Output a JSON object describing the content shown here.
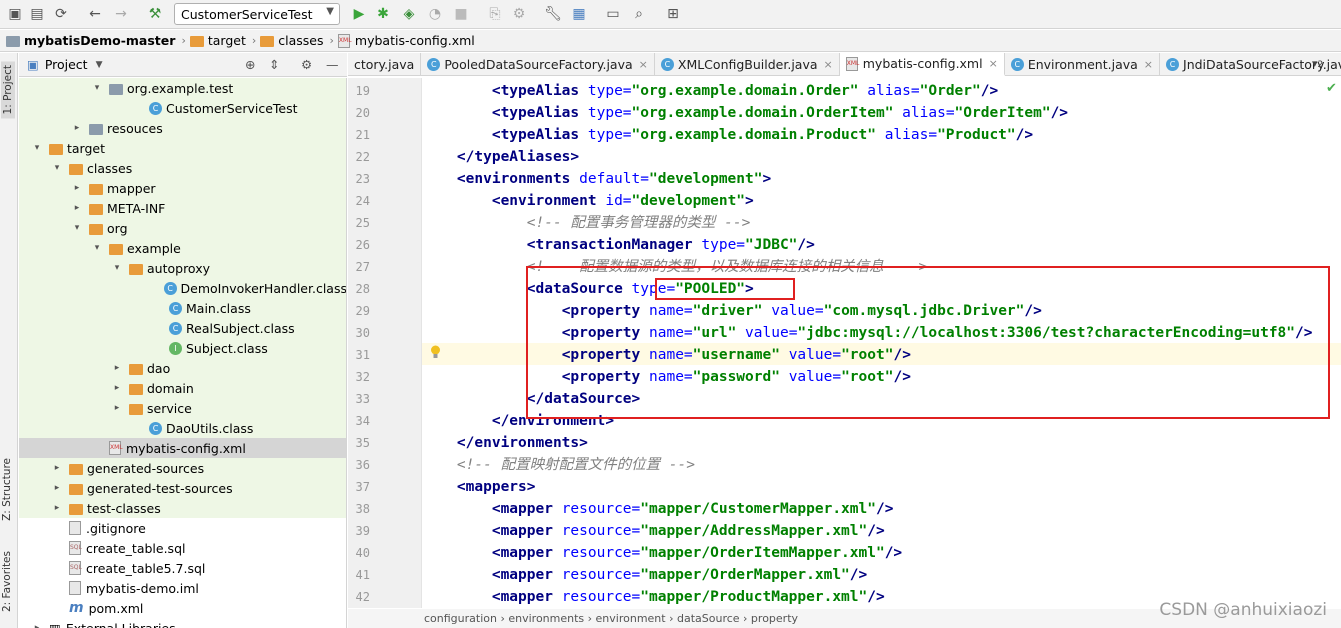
{
  "toolbar": {
    "run_config": "CustomerServiceTest",
    "icons": [
      "open-icon",
      "save-icon",
      "sync-icon",
      "back-icon",
      "forward-icon",
      "build-hammer-icon",
      "run-icon",
      "debug-icon",
      "coverage-icon",
      "profile-icon",
      "stop-icon",
      "vcs-icon",
      "vcs-update-icon",
      "settings-wrench-icon",
      "project-structure-icon",
      "terminal-icon",
      "search-icon",
      "sdk-icon"
    ]
  },
  "breadcrumb": [
    "mybatisDemo-master",
    "target",
    "classes",
    "mybatis-config.xml"
  ],
  "left_strip": {
    "project_tab": "1: Project",
    "structure_tab": "Z: Structure",
    "favorites_tab": "2: Favorites"
  },
  "project_panel": {
    "title": "Project"
  },
  "tree": [
    {
      "label": "org.example.test",
      "indent": 4,
      "arrow": "▾",
      "icon": "pkg",
      "green": true
    },
    {
      "label": "CustomerServiceTest",
      "indent": 6,
      "arrow": "",
      "icon": "class",
      "green": true
    },
    {
      "label": "resouces",
      "indent": 3,
      "arrow": "▸",
      "icon": "folder-gray",
      "green": true
    },
    {
      "label": "target",
      "indent": 1,
      "arrow": "▾",
      "icon": "folder-orange",
      "green": true
    },
    {
      "label": "classes",
      "indent": 2,
      "arrow": "▾",
      "icon": "folder-orange",
      "green": true
    },
    {
      "label": "mapper",
      "indent": 3,
      "arrow": "▸",
      "icon": "folder-orange",
      "green": true
    },
    {
      "label": "META-INF",
      "indent": 3,
      "arrow": "▸",
      "icon": "folder-orange",
      "green": true
    },
    {
      "label": "org",
      "indent": 3,
      "arrow": "▾",
      "icon": "folder-orange",
      "green": true
    },
    {
      "label": "example",
      "indent": 4,
      "arrow": "▾",
      "icon": "folder-orange",
      "green": true
    },
    {
      "label": "autoproxy",
      "indent": 5,
      "arrow": "▾",
      "icon": "folder-orange",
      "green": true
    },
    {
      "label": "DemoInvokerHandler.class",
      "indent": 7,
      "arrow": "",
      "icon": "class",
      "green": true
    },
    {
      "label": "Main.class",
      "indent": 7,
      "arrow": "",
      "icon": "class",
      "green": true
    },
    {
      "label": "RealSubject.class",
      "indent": 7,
      "arrow": "",
      "icon": "class",
      "green": true
    },
    {
      "label": "Subject.class",
      "indent": 7,
      "arrow": "",
      "icon": "iface",
      "green": true
    },
    {
      "label": "dao",
      "indent": 5,
      "arrow": "▸",
      "icon": "folder-orange",
      "green": true
    },
    {
      "label": "domain",
      "indent": 5,
      "arrow": "▸",
      "icon": "folder-orange",
      "green": true
    },
    {
      "label": "service",
      "indent": 5,
      "arrow": "▸",
      "icon": "folder-orange",
      "green": true
    },
    {
      "label": "DaoUtils.class",
      "indent": 6,
      "arrow": "",
      "icon": "class",
      "green": true
    },
    {
      "label": "mybatis-config.xml",
      "indent": 4,
      "arrow": "",
      "icon": "xml",
      "sel": true
    },
    {
      "label": "generated-sources",
      "indent": 2,
      "arrow": "▸",
      "icon": "folder-orange",
      "green": true
    },
    {
      "label": "generated-test-sources",
      "indent": 2,
      "arrow": "▸",
      "icon": "folder-orange",
      "green": true
    },
    {
      "label": "test-classes",
      "indent": 2,
      "arrow": "▸",
      "icon": "folder-orange",
      "green": true
    },
    {
      "label": ".gitignore",
      "indent": 2,
      "arrow": "",
      "icon": "file"
    },
    {
      "label": "create_table.sql",
      "indent": 2,
      "arrow": "",
      "icon": "sql"
    },
    {
      "label": "create_table5.7.sql",
      "indent": 2,
      "arrow": "",
      "icon": "sql"
    },
    {
      "label": "mybatis-demo.iml",
      "indent": 2,
      "arrow": "",
      "icon": "file"
    },
    {
      "label": "pom.xml",
      "indent": 2,
      "arrow": "",
      "icon": "maven"
    },
    {
      "label": "External Libraries",
      "indent": 1,
      "arrow": "▸",
      "icon": "lib"
    }
  ],
  "tabs": [
    {
      "label": "ctory.java",
      "active": false,
      "icon": "class"
    },
    {
      "label": "PooledDataSourceFactory.java",
      "active": false,
      "icon": "class"
    },
    {
      "label": "XMLConfigBuilder.java",
      "active": false,
      "icon": "class"
    },
    {
      "label": "mybatis-config.xml",
      "active": true,
      "icon": "xml"
    },
    {
      "label": "Environment.java",
      "active": false,
      "icon": "class"
    },
    {
      "label": "JndiDataSourceFactory.java",
      "active": false,
      "icon": "class"
    }
  ],
  "tab_overflow": "2",
  "line_numbers": [
    "19",
    "20",
    "21",
    "22",
    "23",
    "24",
    "25",
    "26",
    "27",
    "28",
    "29",
    "30",
    "31",
    "32",
    "33",
    "34",
    "35",
    "36",
    "37",
    "38",
    "39",
    "40",
    "41",
    "42"
  ],
  "code_lines": [
    [
      [
        "i",
        "        "
      ],
      [
        "t",
        "<typeAlias "
      ],
      [
        "a",
        "type="
      ],
      [
        "v",
        "\"org.example.domain.Order\""
      ],
      [
        "a",
        " alias="
      ],
      [
        "v",
        "\"Order\""
      ],
      [
        "t",
        "/>"
      ]
    ],
    [
      [
        "i",
        "        "
      ],
      [
        "t",
        "<typeAlias "
      ],
      [
        "a",
        "type="
      ],
      [
        "v",
        "\"org.example.domain.OrderItem\""
      ],
      [
        "a",
        " alias="
      ],
      [
        "v",
        "\"OrderItem\""
      ],
      [
        "t",
        "/>"
      ]
    ],
    [
      [
        "i",
        "        "
      ],
      [
        "t",
        "<typeAlias "
      ],
      [
        "a",
        "type="
      ],
      [
        "v",
        "\"org.example.domain.Product\""
      ],
      [
        "a",
        " alias="
      ],
      [
        "v",
        "\"Product\""
      ],
      [
        "t",
        "/>"
      ]
    ],
    [
      [
        "i",
        "    "
      ],
      [
        "t",
        "</typeAliases>"
      ]
    ],
    [
      [
        "i",
        "    "
      ],
      [
        "t",
        "<environments "
      ],
      [
        "a",
        "default="
      ],
      [
        "v",
        "\"development\""
      ],
      [
        "t",
        ">"
      ]
    ],
    [
      [
        "i",
        "        "
      ],
      [
        "t",
        "<environment "
      ],
      [
        "a",
        "id="
      ],
      [
        "v",
        "\"development\""
      ],
      [
        "t",
        ">"
      ]
    ],
    [
      [
        "i",
        "            "
      ],
      [
        "c",
        "<!-- 配置事务管理器的类型 -->"
      ]
    ],
    [
      [
        "i",
        "            "
      ],
      [
        "t",
        "<transactionManager "
      ],
      [
        "a",
        "type="
      ],
      [
        "v",
        "\"JDBC\""
      ],
      [
        "t",
        "/>"
      ]
    ],
    [
      [
        "i",
        "            "
      ],
      [
        "c",
        "<!--  配置数据源的类型，以及数据库连接的相关信息  -->"
      ]
    ],
    [
      [
        "i",
        "            "
      ],
      [
        "t",
        "<dataSource "
      ],
      [
        "a",
        "type="
      ],
      [
        "v",
        "\"POOLED\""
      ],
      [
        "t",
        ">"
      ]
    ],
    [
      [
        "i",
        "                "
      ],
      [
        "t",
        "<property "
      ],
      [
        "a",
        "name="
      ],
      [
        "v",
        "\"driver\""
      ],
      [
        "a",
        " value="
      ],
      [
        "v",
        "\"com.mysql.jdbc.Driver\""
      ],
      [
        "t",
        "/>"
      ]
    ],
    [
      [
        "i",
        "                "
      ],
      [
        "t",
        "<property "
      ],
      [
        "a",
        "name="
      ],
      [
        "v",
        "\"url\""
      ],
      [
        "a",
        " value="
      ],
      [
        "v",
        "\"jdbc:mysql://localhost:3306/test?characterEncoding=utf8\""
      ],
      [
        "t",
        "/>"
      ]
    ],
    [
      [
        "i",
        "                "
      ],
      [
        "t",
        "<property "
      ],
      [
        "a",
        "name="
      ],
      [
        "v",
        "\"username\""
      ],
      [
        "a",
        " value="
      ],
      [
        "v",
        "\"root\""
      ],
      [
        "t",
        "/>"
      ]
    ],
    [
      [
        "i",
        "                "
      ],
      [
        "t",
        "<property "
      ],
      [
        "a",
        "name="
      ],
      [
        "v",
        "\"password\""
      ],
      [
        "a",
        " value="
      ],
      [
        "v",
        "\"root\""
      ],
      [
        "t",
        "/>"
      ]
    ],
    [
      [
        "i",
        "            "
      ],
      [
        "t",
        "</dataSource>"
      ]
    ],
    [
      [
        "i",
        "        "
      ],
      [
        "t",
        "</environment>"
      ]
    ],
    [
      [
        "i",
        "    "
      ],
      [
        "t",
        "</environments>"
      ]
    ],
    [
      [
        "i",
        "    "
      ],
      [
        "c",
        "<!-- 配置映射配置文件的位置 -->"
      ]
    ],
    [
      [
        "i",
        "    "
      ],
      [
        "t",
        "<mappers>"
      ]
    ],
    [
      [
        "i",
        "        "
      ],
      [
        "t",
        "<mapper "
      ],
      [
        "a",
        "resource="
      ],
      [
        "v",
        "\"mapper/CustomerMapper.xml\""
      ],
      [
        "t",
        "/>"
      ]
    ],
    [
      [
        "i",
        "        "
      ],
      [
        "t",
        "<mapper "
      ],
      [
        "a",
        "resource="
      ],
      [
        "v",
        "\"mapper/AddressMapper.xml\""
      ],
      [
        "t",
        "/>"
      ]
    ],
    [
      [
        "i",
        "        "
      ],
      [
        "t",
        "<mapper "
      ],
      [
        "a",
        "resource="
      ],
      [
        "v",
        "\"mapper/OrderItemMapper.xml\""
      ],
      [
        "t",
        "/>"
      ]
    ],
    [
      [
        "i",
        "        "
      ],
      [
        "t",
        "<mapper "
      ],
      [
        "a",
        "resource="
      ],
      [
        "v",
        "\"mapper/OrderMapper.xml\""
      ],
      [
        "t",
        "/>"
      ]
    ],
    [
      [
        "i",
        "        "
      ],
      [
        "t",
        "<mapper "
      ],
      [
        "a",
        "resource="
      ],
      [
        "v",
        "\"mapper/ProductMapper.xml\""
      ],
      [
        "t",
        "/>"
      ]
    ]
  ],
  "status_path": "configuration  ›  environments  ›  environment  ›  dataSource  ›  property",
  "watermark": "CSDN @anhuixiaozi"
}
